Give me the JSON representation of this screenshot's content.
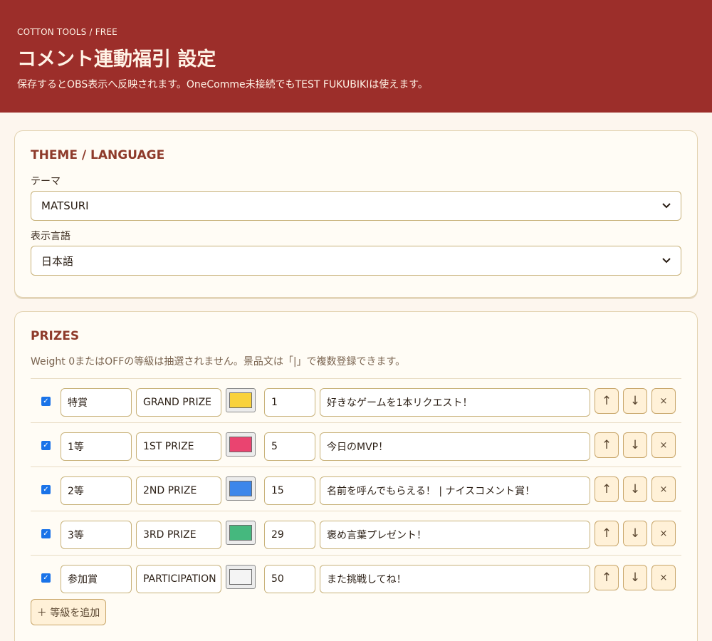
{
  "header": {
    "brand": "COTTON TOOLS / FREE",
    "title": "コメント連動福引 設定",
    "subtitle": "保存するとOBS表示へ反映されます。OneComme未接続でもTEST FUKUBIKIは使えます。"
  },
  "theme_section": {
    "title": "THEME / LANGUAGE",
    "theme_label": "テーマ",
    "theme_value": "MATSURI",
    "language_label": "表示言語",
    "language_value": "日本語"
  },
  "prizes_section": {
    "title": "PRIZES",
    "note": "Weight 0またはOFFの等級は抽選されません。景品文は「|」で複数登録できます。",
    "rows": [
      {
        "enabled": true,
        "rank": "特賞",
        "label": "GRAND PRIZE",
        "color": "#f9d23c",
        "weight": "1",
        "text": "好きなゲームを1本リクエスト！"
      },
      {
        "enabled": true,
        "rank": "1等",
        "label": "1ST PRIZE",
        "color": "#ea4470",
        "weight": "5",
        "text": "今日のMVP！"
      },
      {
        "enabled": true,
        "rank": "2等",
        "label": "2ND PRIZE",
        "color": "#3c86ea",
        "weight": "15",
        "text": "名前を呼んでもらえる！ | ナイスコメント賞！"
      },
      {
        "enabled": true,
        "rank": "3等",
        "label": "3RD PRIZE",
        "color": "#45b87e",
        "weight": "29",
        "text": "褒め言葉プレゼント！"
      },
      {
        "enabled": true,
        "rank": "参加賞",
        "label": "PARTICIPATION",
        "color": "#f4f4f4",
        "weight": "50",
        "text": "また挑戦してね！"
      }
    ],
    "up_label": "↑",
    "down_label": "↓",
    "delete_label": "×",
    "add_label": "＋ 等級を追加"
  }
}
